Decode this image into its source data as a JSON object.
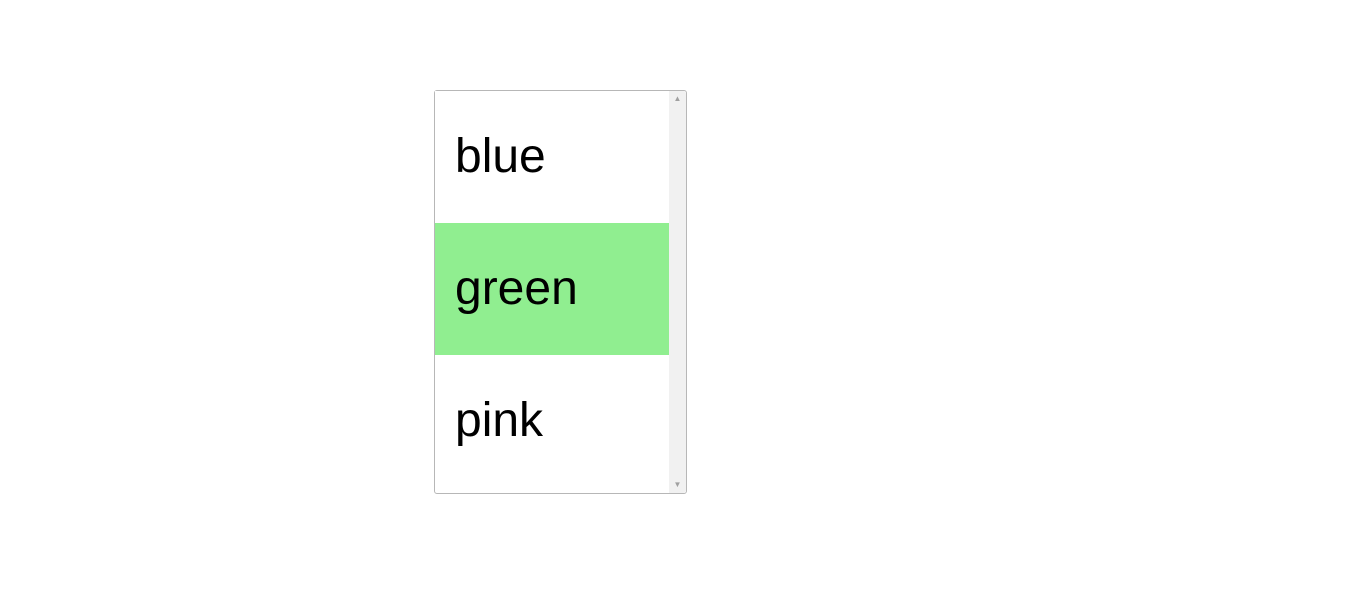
{
  "listbox": {
    "options": [
      {
        "label": "blue",
        "selected": false
      },
      {
        "label": "green",
        "selected": true
      },
      {
        "label": "pink",
        "selected": false
      }
    ],
    "selected_highlight_color": "#90ee90"
  }
}
